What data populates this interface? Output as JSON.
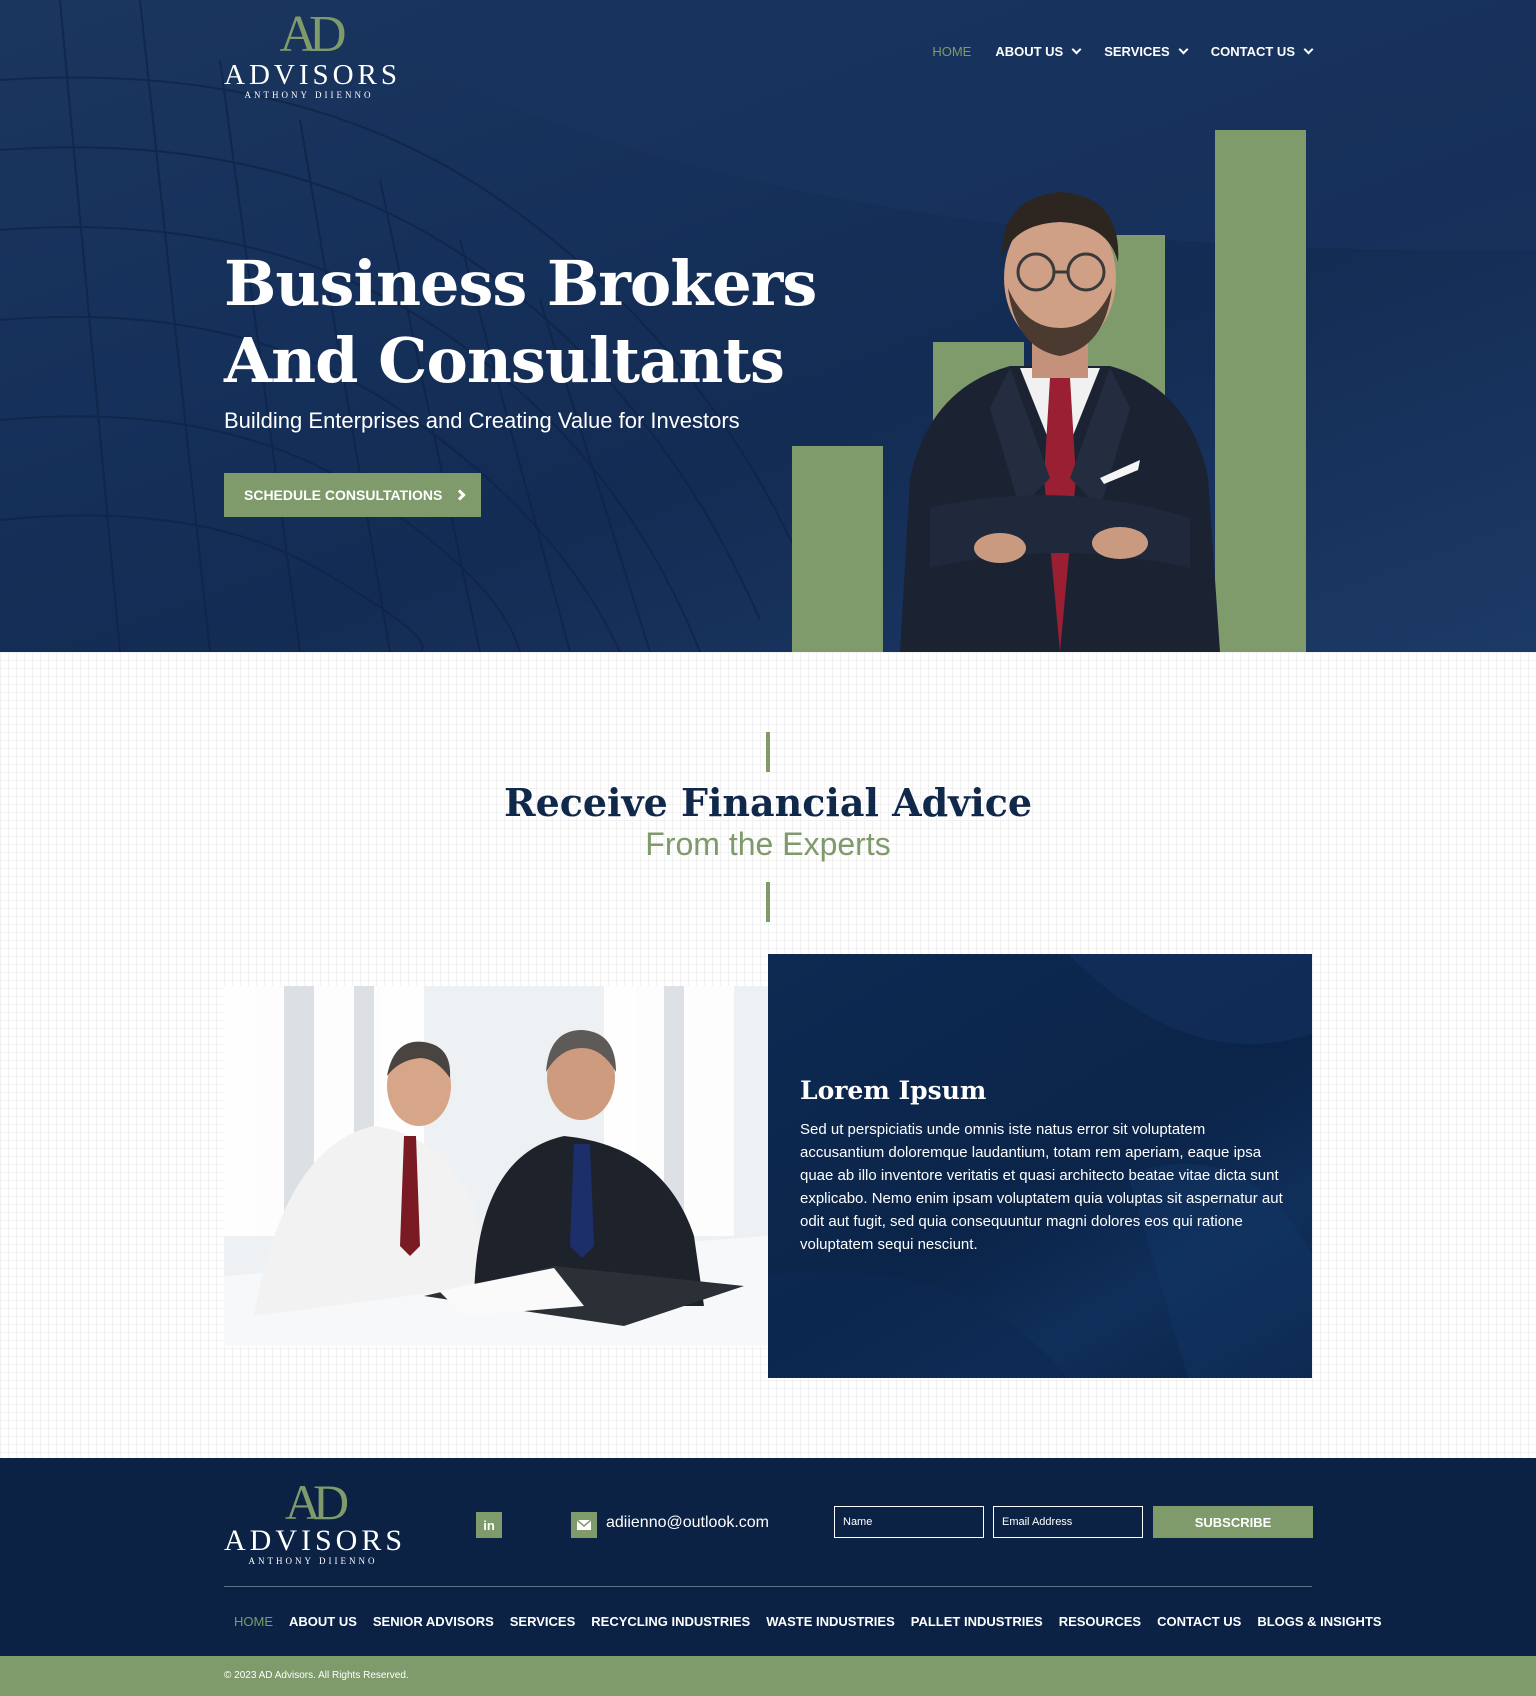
{
  "brand": {
    "logo_mark": "AD",
    "logo_word": "ADVISORS",
    "logo_sub": "ANTHONY DIIENNO"
  },
  "nav": {
    "items": [
      {
        "label": "HOME",
        "active": true,
        "dropdown": false
      },
      {
        "label": "ABOUT US",
        "active": false,
        "dropdown": true
      },
      {
        "label": "SERVICES",
        "active": false,
        "dropdown": true
      },
      {
        "label": "CONTACT US",
        "active": false,
        "dropdown": true
      }
    ]
  },
  "hero": {
    "title_line1": "Business Brokers",
    "title_line2": "And Consultants",
    "subtitle": "Building Enterprises and Creating Value for Investors",
    "cta_label": "SCHEDULE CONSULTATIONS"
  },
  "section": {
    "title": "Receive Financial Advice",
    "subtitle": "From the Experts",
    "card_title": "Lorem Ipsum",
    "card_text": "Sed ut perspiciatis unde omnis iste natus error sit voluptatem accusantium doloremque laudantium, totam rem aperiam, eaque ipsa quae ab illo inventore veritatis et quasi architecto beatae vitae dicta sunt explicabo. Nemo enim ipsam voluptatem quia voluptas sit aspernatur aut odit aut fugit, sed quia consequuntur magni dolores eos qui ratione voluptatem sequi nesciunt."
  },
  "footer": {
    "linkedin_icon": "in",
    "email": "adiienno@outlook.com",
    "name_placeholder": "Name",
    "email_placeholder": "Email Address",
    "subscribe_label": "SUBSCRIBE",
    "links": [
      {
        "label": "HOME",
        "active": true
      },
      {
        "label": "ABOUT US",
        "active": false
      },
      {
        "label": "SENIOR ADVISORS",
        "active": false
      },
      {
        "label": "SERVICES",
        "active": false
      },
      {
        "label": "RECYCLING INDUSTRIES",
        "active": false
      },
      {
        "label": "WASTE INDUSTRIES",
        "active": false
      },
      {
        "label": "PALLET INDUSTRIES",
        "active": false
      },
      {
        "label": "RESOURCES",
        "active": false
      },
      {
        "label": "CONTACT US",
        "active": false
      },
      {
        "label": "BLOGS & INSIGHTS",
        "active": false
      }
    ],
    "copyright": "© 2023 AD Advisors. All Rights Reserved."
  },
  "colors": {
    "navy": "#10284a",
    "accent_green": "#7f9a6b",
    "footer_bg": "#0b2245"
  }
}
